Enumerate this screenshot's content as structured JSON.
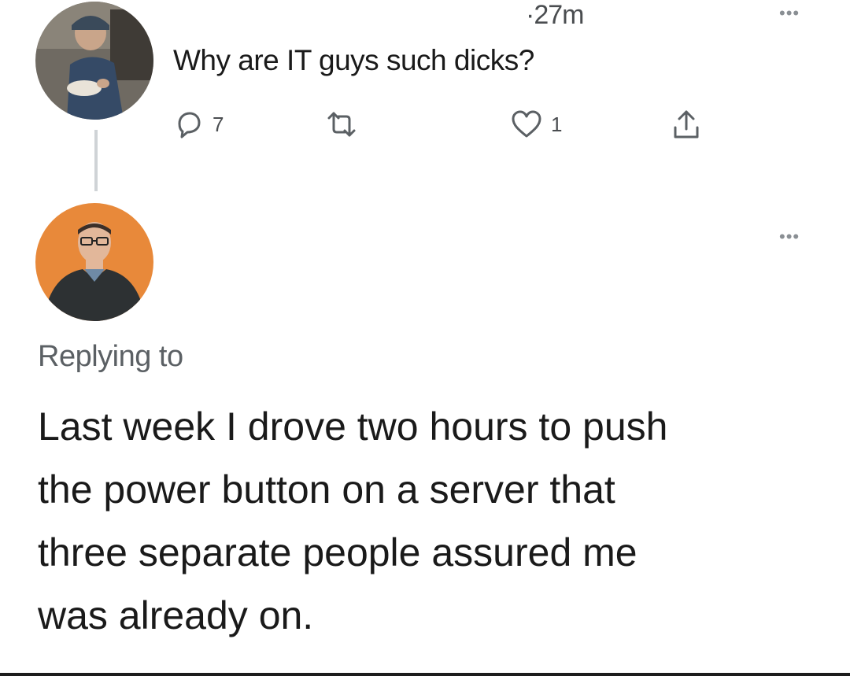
{
  "tweet": {
    "timestamp": "·27m",
    "more_label": "•••",
    "text": "Why are IT guys such dicks?",
    "actions": {
      "reply_icon": "reply-icon",
      "reply_count": "7",
      "retweet_icon": "retweet-icon",
      "like_icon": "heart-icon",
      "like_count": "1",
      "share_icon": "share-icon"
    }
  },
  "reply": {
    "more_label": "•••",
    "replying_to": "Replying to",
    "lines": [
      "Last week I drove two hours to push",
      "the power button on a server that",
      "three separate people assured me",
      "was already on."
    ]
  },
  "colors": {
    "text": "#1a1a1a",
    "muted": "#5b6064",
    "thread_line": "#cfd3d6",
    "avatar2_bg": "#e8893a"
  }
}
